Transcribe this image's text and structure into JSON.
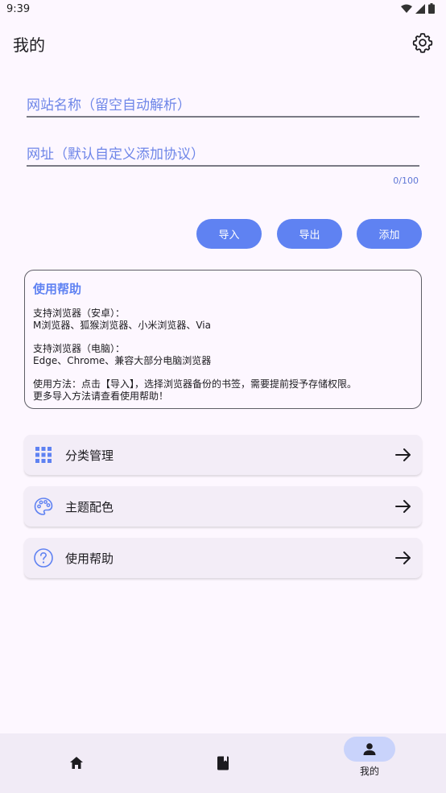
{
  "status": {
    "time": "9:39"
  },
  "appbar": {
    "title": "我的"
  },
  "form": {
    "site_name_placeholder": "网站名称（留空自动解析）",
    "url_placeholder": "网址（默认自定义添加协议）",
    "counter": "0/100"
  },
  "buttons": {
    "import": "导入",
    "export": "导出",
    "add": "添加"
  },
  "help": {
    "title": "使用帮助",
    "android_title": "支持浏览器（安卓）：",
    "android_list": "M浏览器、狐猴浏览器、小米浏览器、Via",
    "pc_title": "支持浏览器（电脑）：",
    "pc_list": "Edge、Chrome、兼容大部分电脑浏览器",
    "usage": "使用方法：点击【导入】，选择浏览器备份的书签，需要提前授予存储权限。",
    "more": "更多导入方法请查看使用帮助！"
  },
  "menu": [
    {
      "label": "分类管理",
      "icon": "grid-icon"
    },
    {
      "label": "主题配色",
      "icon": "palette-icon"
    },
    {
      "label": "使用帮助",
      "icon": "help-icon"
    }
  ],
  "bottom_nav": {
    "items": [
      {
        "icon": "home-icon"
      },
      {
        "icon": "book-icon"
      },
      {
        "icon": "person-icon",
        "label": "我的",
        "active": true
      }
    ]
  },
  "colors": {
    "accent": "#5f82f2",
    "background": "#fdf7ff",
    "card": "#f3edf7",
    "nav_active": "#c9d3fb"
  }
}
